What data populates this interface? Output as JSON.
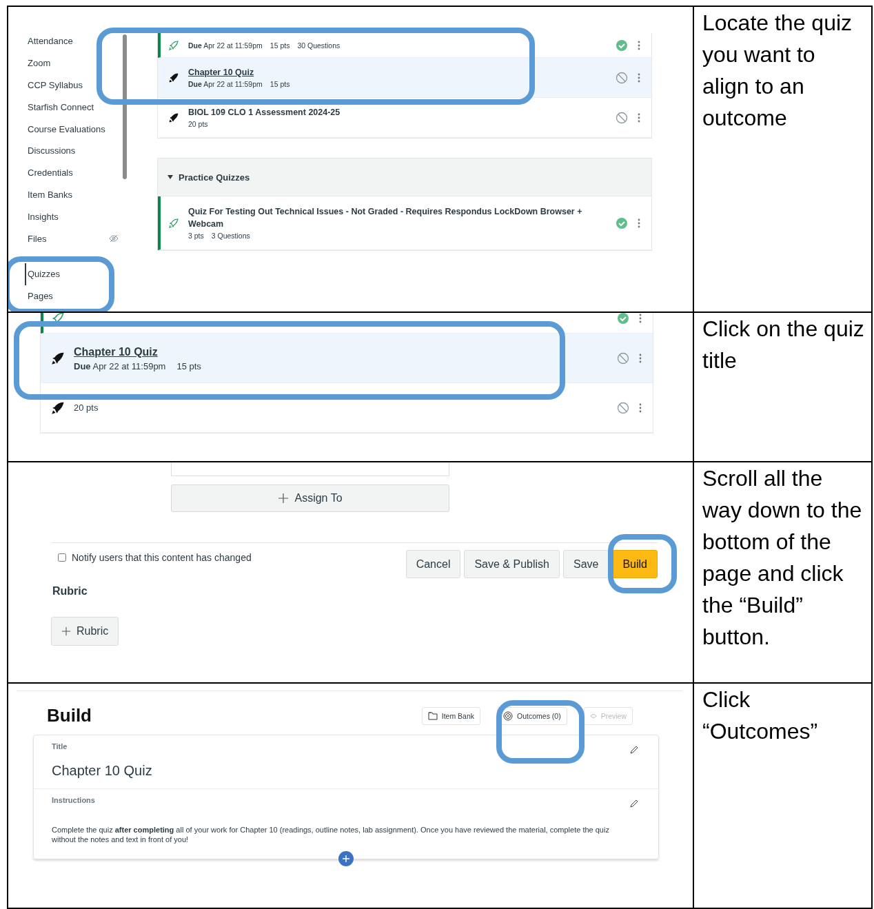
{
  "steps": [
    {
      "instruction": "Locate the quiz you want to align to an outcome",
      "nav": [
        {
          "label": "Attendance",
          "selected": false,
          "hidden": false
        },
        {
          "label": "Zoom",
          "selected": false,
          "hidden": false
        },
        {
          "label": "CCP Syllabus",
          "selected": false,
          "hidden": false
        },
        {
          "label": "Starfish Connect",
          "selected": false,
          "hidden": false
        },
        {
          "label": "Course Evaluations",
          "selected": false,
          "hidden": false
        },
        {
          "label": "Discussions",
          "selected": false,
          "hidden": false
        },
        {
          "label": "Credentials",
          "selected": false,
          "hidden": false
        },
        {
          "label": "Item Banks",
          "selected": false,
          "hidden": false
        },
        {
          "label": "Insights",
          "selected": false,
          "hidden": false
        },
        {
          "label": "Files",
          "selected": false,
          "hidden": true
        },
        {
          "label": "Quizzes",
          "selected": true,
          "hidden": false
        },
        {
          "label": "Pages",
          "selected": false,
          "hidden": false
        }
      ],
      "quizzes": [
        {
          "meta": [
            "**Due** Apr 22 at 11:59pm",
            "15 pts",
            "30 Questions"
          ],
          "published": true,
          "selected": false
        },
        {
          "title": "Chapter 10 Quiz",
          "meta": [
            "**Due** Apr 22 at 11:59pm",
            "15 pts"
          ],
          "published": false,
          "selected": true
        },
        {
          "title": "BIOL 109 CLO 1 Assessment 2024-25",
          "meta": [
            "20 pts"
          ],
          "published": false,
          "selected": false
        }
      ],
      "group": {
        "title": "Practice Quizzes",
        "expanded": true,
        "quizzes": [
          {
            "title": "Quiz For Testing Out Technical Issues - Not Graded - Requires Respondus LockDown Browser + Webcam",
            "meta": [
              "3 pts",
              "3 Questions"
            ],
            "published": true,
            "selected": false
          }
        ]
      }
    },
    {
      "instruction": "Click on the quiz title",
      "quizzes": [
        {
          "published": true,
          "selected": false
        },
        {
          "title": "Chapter 10 Quiz",
          "meta": [
            "**Due** Apr 22 at 11:59pm",
            "15 pts"
          ],
          "published": false,
          "selected": true
        },
        {
          "meta": [
            "20 pts"
          ],
          "published": false,
          "selected": false
        }
      ]
    },
    {
      "instruction": "Scroll all the way down to the bottom of the page and click the “Build” button.",
      "assign_button": "Assign To",
      "notify": {
        "label": "Notify users that this content has changed",
        "checked": false
      },
      "buttons": [
        {
          "label": "Cancel",
          "kind": "default"
        },
        {
          "label": "Save & Publish",
          "kind": "default"
        },
        {
          "label": "Save",
          "kind": "default"
        },
        {
          "label": "Build",
          "kind": "primary"
        }
      ],
      "rubric_heading": "Rubric",
      "rubric_button": "Rubric"
    },
    {
      "instruction": "Click “Outcomes”",
      "heading": "Build",
      "tools": [
        {
          "label": "Item Bank",
          "kind": "bank",
          "disabled": false
        },
        {
          "label": "Outcomes (0)",
          "kind": "outcomes",
          "disabled": false
        },
        {
          "label": "Preview",
          "kind": "preview",
          "disabled": true
        }
      ],
      "title_label": "Title",
      "title_value": "Chapter 10 Quiz",
      "instructions_label": "Instructions",
      "instructions_text": "Complete the quiz **after completing** all of your work for Chapter 10 (readings, outline notes, lab assignment).  Once you have reviewed the material, complete the quiz without the notes and text in front of you!"
    }
  ]
}
